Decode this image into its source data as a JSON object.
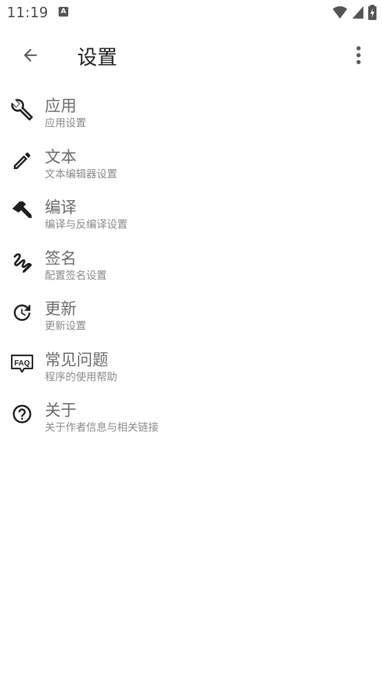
{
  "status_bar": {
    "time": "11:19",
    "notification_badge": "A",
    "icons": [
      "wifi-icon",
      "cellular-signal-icon",
      "battery-charging-icon"
    ]
  },
  "app_bar": {
    "back_icon": "arrow-back-icon",
    "title": "设置",
    "overflow_icon": "more-vert-icon"
  },
  "settings": {
    "items": [
      {
        "icon": "wrench-icon",
        "title": "应用",
        "subtitle": "应用设置"
      },
      {
        "icon": "pencil-icon",
        "title": "文本",
        "subtitle": "文本编辑器设置"
      },
      {
        "icon": "hammer-icon",
        "title": "编译",
        "subtitle": "编译与反编译设置"
      },
      {
        "icon": "signature-icon",
        "title": "签名",
        "subtitle": "配置签名设置"
      },
      {
        "icon": "update-clock-icon",
        "title": "更新",
        "subtitle": "更新设置"
      },
      {
        "icon": "faq-icon",
        "title": "常见问题",
        "subtitle": "程序的使用帮助"
      },
      {
        "icon": "help-circle-icon",
        "title": "关于",
        "subtitle": "关于作者信息与相关链接"
      }
    ]
  },
  "colors": {
    "icon": "#1f1f1f",
    "title_text": "#6b6b6b",
    "subtitle_text": "#8a8a8a",
    "background": "#ffffff"
  }
}
